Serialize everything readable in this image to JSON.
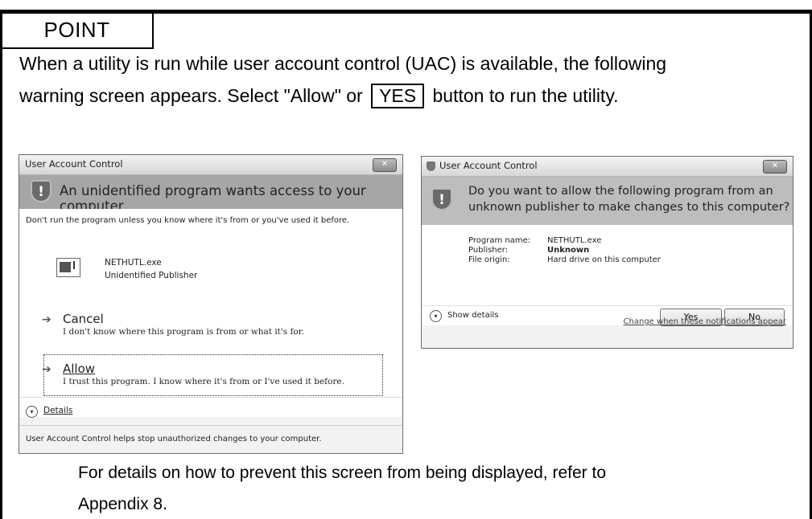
{
  "point": {
    "label": "POINT"
  },
  "intro": {
    "line1": "When a utility is run while user account control (UAC) is available, the following",
    "line2_before": "warning screen appears. Select \"Allow\" or",
    "yes_label": "YES",
    "line2_after": "button to run the utility."
  },
  "dialog1": {
    "title": "User Account Control",
    "close": "✕",
    "heading": "An unidentified program wants access to your computer",
    "warning": "Don't run the program unless you know where it's from or you've used it before.",
    "program_name": "NETHUTL.exe",
    "publisher": "Unidentified Publisher",
    "cancel_title": "Cancel",
    "cancel_desc": "I don't know where this program is from or what it's for.",
    "allow_title": "Allow",
    "allow_desc": "I trust this program. I know where it's from or I've used it before.",
    "details_label": "Details",
    "footer": "User Account Control helps stop unauthorized changes to your computer."
  },
  "dialog2": {
    "title": "User Account Control",
    "close": "✕",
    "heading_line1": "Do you want to allow the following program from an",
    "heading_line2": "unknown publisher to make changes to this computer?",
    "rows": [
      {
        "key": "Program name:",
        "value": "NETHUTL.exe"
      },
      {
        "key": "Publisher:",
        "value": "Unknown"
      },
      {
        "key": "File origin:",
        "value": "Hard drive on this computer"
      }
    ],
    "show_details": "Show details",
    "yes": "Yes",
    "no": "No",
    "link": "Change when these notifications appear"
  },
  "footer": {
    "line1": "For details on how to prevent this screen from being displayed, refer to",
    "line2": "Appendix 8."
  }
}
